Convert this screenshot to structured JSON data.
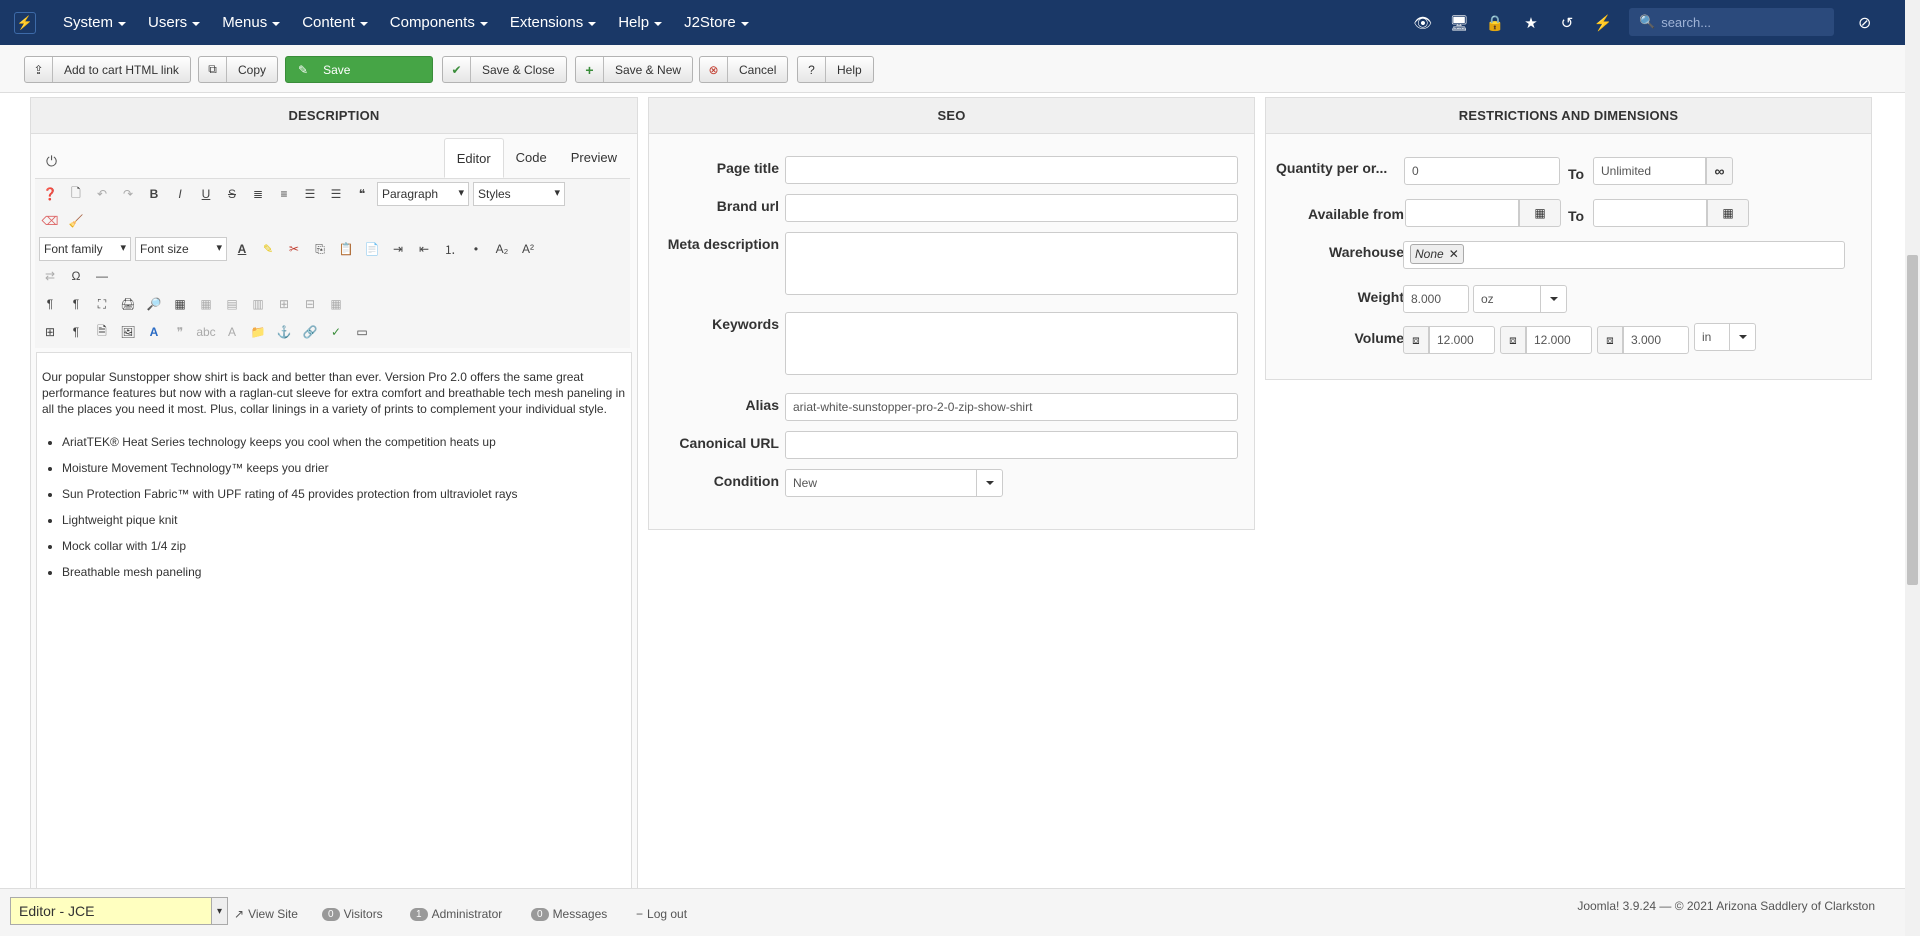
{
  "topnav": {
    "menu": [
      "System",
      "Users",
      "Menus",
      "Content",
      "Components",
      "Extensions",
      "Help",
      "J2Store"
    ],
    "icons": [
      "eye-icon",
      "desktop-icon",
      "lock-icon",
      "star-icon",
      "history-icon",
      "bolt-icon"
    ],
    "search_placeholder": "search...",
    "brand_color": "#1a3867"
  },
  "toolbar": {
    "add_to_cart": "Add to cart HTML link",
    "copy": "Copy",
    "save": "Save",
    "save_close": "Save & Close",
    "save_new": "Save & New",
    "cancel": "Cancel",
    "help": "Help",
    "save_color": "#46a546"
  },
  "description": {
    "heading": "DESCRIPTION",
    "tabs": [
      "Editor",
      "Code",
      "Preview"
    ],
    "paragraph_select": "Paragraph",
    "styles_select": "Styles",
    "font_family_select": "Font family",
    "font_size_select": "Font size",
    "body": "Our popular Sunstopper show shirt is back and better than ever. Version Pro 2.0 offers the same great performance features but now with a raglan-cut sleeve for extra comfort and breathable tech mesh paneling in all the places you need it most. Plus, collar linings in a variety of prints to complement your individual style.",
    "bullets": [
      "AriatTEK® Heat Series technology keeps you cool when the competition heats up",
      "Moisture Movement Technology™ keeps you drier",
      "Sun Protection Fabric™ with UPF rating of 45 provides protection from ultraviolet rays",
      "Lightweight pique knit",
      "Mock collar with 1/4 zip",
      "Breathable mesh paneling"
    ]
  },
  "seo": {
    "heading": "SEO",
    "page_title_label": "Page title",
    "page_title_value": "",
    "brand_url_label": "Brand url",
    "brand_url_value": "",
    "meta_description_label": "Meta description",
    "keywords_label": "Keywords",
    "alias_label": "Alias",
    "alias_value": "ariat-white-sunstopper-pro-2-0-zip-show-shirt",
    "canonical_label": "Canonical URL",
    "canonical_value": "",
    "condition_label": "Condition",
    "condition_value": "New"
  },
  "restrictions": {
    "heading": "RESTRICTIONS AND DIMENSIONS",
    "quantity_label": "Quantity per or...",
    "quantity_min": "0",
    "to_label": "To",
    "quantity_max": "Unlimited",
    "available_from_label": "Available from",
    "warehouse_label": "Warehouse",
    "warehouse_value": "None",
    "weight_label": "Weight",
    "weight_value": "8.000",
    "weight_unit": "oz",
    "volume_label": "Volume",
    "length": "12.000",
    "width": "12.000",
    "height": "3.000",
    "volume_unit": "in"
  },
  "footer": {
    "editor_select": "Editor - JCE",
    "view_site": "View Site",
    "visitors_count": "0",
    "visitors_label": "Visitors",
    "admin_count": "1",
    "admin_label": "Administrator",
    "messages_count": "0",
    "messages_label": "Messages",
    "logout": "Log out",
    "copyright": "Joomla! 3.9.24  —  © 2021 Arizona Saddlery of Clarkston"
  }
}
